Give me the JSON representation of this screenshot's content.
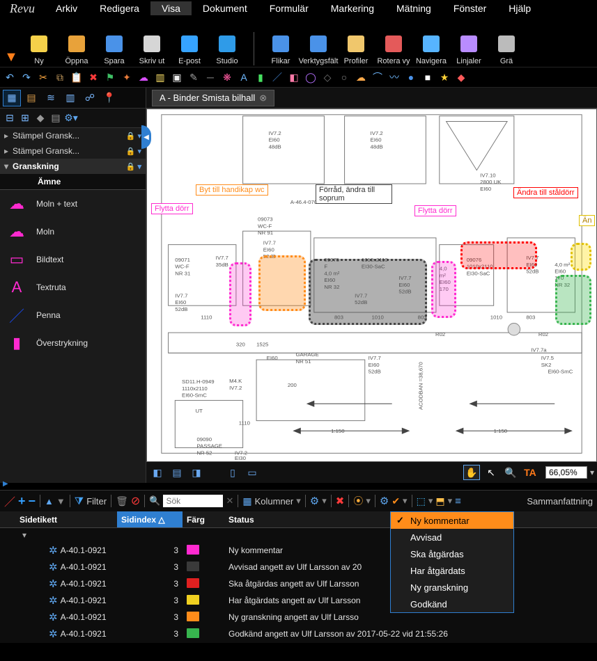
{
  "app_name": "Revu",
  "menubar": [
    "Arkiv",
    "Redigera",
    "Visa",
    "Dokument",
    "Formulär",
    "Markering",
    "Mätning",
    "Fönster",
    "Hjälp"
  ],
  "menubar_active_index": 2,
  "ribbon": [
    {
      "label": "Ny",
      "icon": "new-icon",
      "color": "#f5d14a"
    },
    {
      "label": "Öppna",
      "icon": "open-icon",
      "color": "#e8a23a"
    },
    {
      "label": "Spara",
      "icon": "save-icon",
      "color": "#4a92e8"
    },
    {
      "label": "Skriv ut",
      "icon": "print-icon",
      "color": "#d6d6d6"
    },
    {
      "label": "E-post",
      "icon": "email-icon",
      "color": "#36a3ff"
    },
    {
      "label": "Studio",
      "icon": "studio-icon",
      "color": "#2f9be8"
    }
  ],
  "ribbon2": [
    {
      "label": "Flikar",
      "icon": "tabs-icon",
      "color": "#4a92e8"
    },
    {
      "label": "Verktygsfält",
      "icon": "toolbars-icon",
      "color": "#4a92e8"
    },
    {
      "label": "Profiler",
      "icon": "profiles-icon",
      "color": "#f0c76c"
    },
    {
      "label": "Rotera vy",
      "icon": "rotate-icon",
      "color": "#e45a5a"
    },
    {
      "label": "Navigera",
      "icon": "navigate-icon",
      "color": "#57b4ff"
    },
    {
      "label": "Linjaler",
      "icon": "rulers-icon",
      "color": "#b98cff"
    },
    {
      "label": "Grä",
      "icon": "grid-icon",
      "color": "#bbb"
    }
  ],
  "document_tab": "A - Binder Smista bilhall",
  "tool_chest": {
    "sections": [
      {
        "name": "Stämpel Gransk...",
        "locked": true
      },
      {
        "name": "Stämpel Gransk...",
        "locked": true
      },
      {
        "name": "Granskning",
        "locked": true
      }
    ],
    "header": "Ämne",
    "items": [
      {
        "label": "Moln + text",
        "icon": "cloud-text-icon",
        "color": "#ff2ad0"
      },
      {
        "label": "Moln",
        "icon": "cloud-icon",
        "color": "#ff2ad0"
      },
      {
        "label": "Bildtext",
        "icon": "callout-icon",
        "color": "#ff2ad0"
      },
      {
        "label": "Textruta",
        "icon": "textbox-icon",
        "color": "#ff2ad0"
      },
      {
        "label": "Penna",
        "icon": "pen-icon",
        "color": "#1b4ae8"
      },
      {
        "label": "Överstrykning",
        "icon": "highlight-icon",
        "color": "#ff2ad0"
      }
    ]
  },
  "markup_callouts": {
    "flytta_dorr": "Flytta dörr",
    "byt_handikap": "Byt till handikap wc",
    "forrad_soprum": "Förråd, ändra till soprum",
    "flytta_dorr2": "Flytta dörr",
    "andra_staldorr": "Ändra till ståldörr",
    "an": "Än"
  },
  "zoom_value": "66,05%",
  "markups_toolbar": {
    "filter_label": "Filter",
    "search_placeholder": "Sök",
    "columns_label": "Kolumner",
    "summary_label": "Sammanfattning"
  },
  "markups_headers": {
    "page_label": "Sidetikett",
    "page_index": "Sidindex",
    "color": "Färg",
    "status": "Status"
  },
  "markups_rows": [
    {
      "page": "A-40.1-0921",
      "idx": "3",
      "color": "#ff2ad0",
      "status": "Ny kommentar"
    },
    {
      "page": "A-40.1-0921",
      "idx": "3",
      "color": "#3a3a3a",
      "status": "Avvisad angett av Ulf Larsson av 20"
    },
    {
      "page": "A-40.1-0921",
      "idx": "3",
      "color": "#e02020",
      "status": "Ska åtgärdas angett av Ulf Larsson"
    },
    {
      "page": "A-40.1-0921",
      "idx": "3",
      "color": "#f0d020",
      "status": "Har åtgärdats angett av Ulf Larsson"
    },
    {
      "page": "A-40.1-0921",
      "idx": "3",
      "color": "#ff8c1a",
      "status": "Ny granskning angett av Ulf Larsso"
    },
    {
      "page": "A-40.1-0921",
      "idx": "3",
      "color": "#37b44e",
      "status": "Godkänd angett av Ulf Larsson av 2017-05-22 vid 21:55:26"
    }
  ],
  "status_menu": [
    "Ny kommentar",
    "Avvisad",
    "Ska åtgärdas",
    "Har åtgärdats",
    "Ny granskning",
    "Godkänd"
  ]
}
